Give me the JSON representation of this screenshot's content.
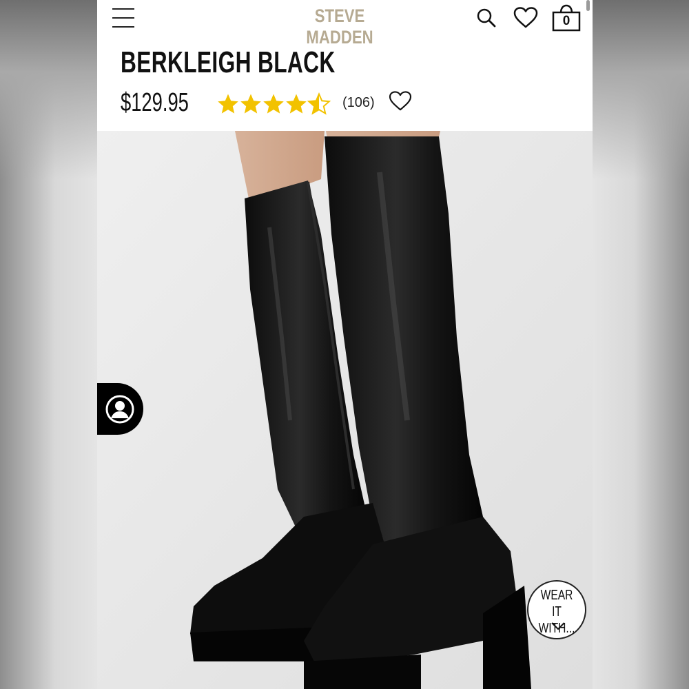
{
  "header": {
    "brand": "STEVE MADDEN",
    "cart_count": "0",
    "icons": [
      "menu-icon",
      "search-icon",
      "heart-icon",
      "shopping-bag-icon"
    ]
  },
  "product": {
    "title": "BERKLEIGH BLACK",
    "price": "$129.95",
    "rating": 4.5,
    "rating_max": 5,
    "review_count": "(106)"
  },
  "overlay": {
    "wear_line1": "WEAR IT",
    "wear_line2": "WITH..."
  },
  "colors": {
    "brand": "#b6aa92",
    "star": "#f2c200",
    "text": "#111111"
  }
}
